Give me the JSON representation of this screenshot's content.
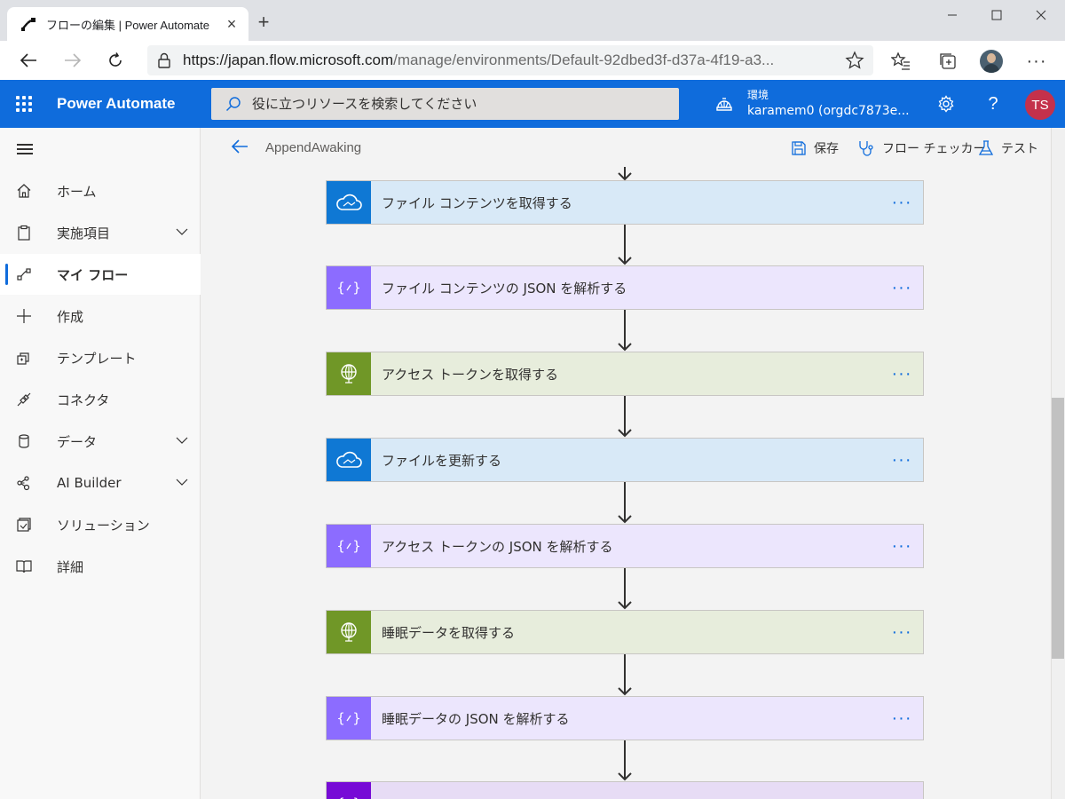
{
  "browser": {
    "tab_title": "フローの編集 | Power Automate",
    "url_host": "https://japan.flow.microsoft.com",
    "url_path": "/manage/environments/Default-92dbed3f-d37a-4f19-a3..."
  },
  "header": {
    "app_name": "Power Automate",
    "search_placeholder": "役に立つリソースを検索してください",
    "env_label": "環境",
    "env_name": "karamem0 (orgdc7873e...",
    "user_initials": "TS",
    "accent_color": "#0f6cdc"
  },
  "sidebar": {
    "items": [
      {
        "label": "ホーム",
        "icon": "home-icon"
      },
      {
        "label": "実施項目",
        "icon": "clipboard-icon",
        "expandable": true
      },
      {
        "label": "マイ フロー",
        "icon": "flow-icon",
        "active": true
      },
      {
        "label": "作成",
        "icon": "plus-icon"
      },
      {
        "label": "テンプレート",
        "icon": "template-icon"
      },
      {
        "label": "コネクタ",
        "icon": "connector-icon"
      },
      {
        "label": "データ",
        "icon": "database-icon",
        "expandable": true
      },
      {
        "label": "AI Builder",
        "icon": "ai-builder-icon",
        "expandable": true
      },
      {
        "label": "ソリューション",
        "icon": "solution-icon"
      },
      {
        "label": "詳細",
        "icon": "book-icon"
      }
    ]
  },
  "command_bar": {
    "flow_name": "AppendAwaking",
    "save_label": "保存",
    "checker_label": "フロー チェッカー",
    "test_label": "テスト"
  },
  "steps": [
    {
      "title": "ファイル コンテンツを取得する",
      "kind": "onedrive",
      "icon": "onedrive-cloud-icon",
      "color": "#0f78d4",
      "bg": "#d8e9f7"
    },
    {
      "title": "ファイル コンテンツの JSON を解析する",
      "kind": "data-operation",
      "icon": "parse-json-icon",
      "color": "#8c6cff",
      "bg": "#ece6fd"
    },
    {
      "title": "アクセス トークンを取得する",
      "kind": "http",
      "icon": "http-globe-icon",
      "color": "#709727",
      "bg": "#e7eddc"
    },
    {
      "title": "ファイルを更新する",
      "kind": "onedrive",
      "icon": "onedrive-cloud-icon",
      "color": "#0f78d4",
      "bg": "#d8e9f7"
    },
    {
      "title": "アクセス トークンの JSON を解析する",
      "kind": "data-operation",
      "icon": "parse-json-icon",
      "color": "#8c6cff",
      "bg": "#ece6fd"
    },
    {
      "title": "睡眠データを取得する",
      "kind": "http",
      "icon": "http-globe-icon",
      "color": "#709727",
      "bg": "#e7eddc"
    },
    {
      "title": "睡眠データの JSON を解析する",
      "kind": "data-operation",
      "icon": "parse-json-icon",
      "color": "#8c6cff",
      "bg": "#ece6fd"
    },
    {
      "title": "",
      "kind": "variable",
      "icon": "variable-icon",
      "color": "#770bd6",
      "bg": "#e7dcf5"
    }
  ]
}
